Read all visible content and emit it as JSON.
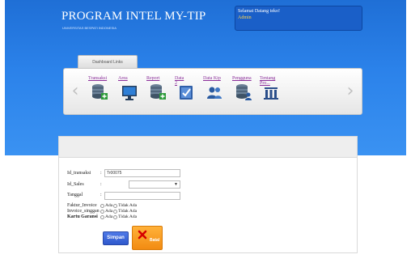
{
  "header": {
    "title": "PROGRAM INTEL MY-TIP",
    "subtitle": "UNIVERSITAS BESPATI INDONESIA",
    "welcome_text": "Selamat Datang teko!",
    "welcome_user": "Admin"
  },
  "dashboard": {
    "tab_label": "Dashboard Links",
    "menu": [
      {
        "label": "Transaksi",
        "icon": "database-add-icon"
      },
      {
        "label": "Area",
        "icon": "monitor-icon"
      },
      {
        "label": "Report",
        "icon": "database-report-icon"
      },
      {
        "label": "Data",
        "icon": "checklist-icon"
      },
      {
        "label": "Data Kip",
        "icon": "users-icon"
      },
      {
        "label": "Pengguna",
        "icon": "database-user-icon"
      },
      {
        "label": "Tentang",
        "icon": "building-icon"
      }
    ],
    "menu_extra_labels": {
      "data": "2",
      "tentang": "Pro..."
    }
  },
  "form": {
    "fields": {
      "id_transaksi": {
        "label": "Id_transaksi",
        "value": "Tr00075"
      },
      "id_sales": {
        "label": "Id_Sales",
        "value": ""
      },
      "tanggal": {
        "label": "Tanggal",
        "value": ""
      }
    },
    "radios": {
      "faktur_invoice": {
        "label": "Faktur_Invoice",
        "option_yes": "Ada",
        "option_no": "Tidak Ada"
      },
      "invoice_singgan": {
        "label": "Invoice_singgan",
        "option_yes": "Ada",
        "option_no": "Tidak Ada"
      },
      "kartu_garansi": {
        "label": "Kartu Garansi",
        "option_yes": "Ada",
        "option_no": "Tidak Ada"
      }
    },
    "buttons": {
      "save": "Simpan",
      "cancel": "Batal"
    }
  }
}
